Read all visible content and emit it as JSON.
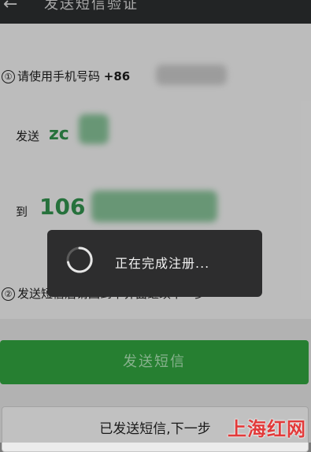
{
  "header": {
    "title": "发送短信验证",
    "back_icon": "back-arrow-icon"
  },
  "steps": [
    {
      "number": "①",
      "text": "请使用手机号码",
      "value": "+86"
    },
    {
      "number": "②",
      "text": "发送短信后请回到本界面继续下一步"
    }
  ],
  "sms": {
    "send_label": "发送",
    "code_prefix": "zc",
    "to_label": "到",
    "number_prefix": "106"
  },
  "buttons": {
    "send_sms": "发送短信",
    "sent_next": "已发送短信,下一步"
  },
  "dialog": {
    "message": "正在完成注册...",
    "spinner_icon": "loading-spinner-icon"
  },
  "watermark": {
    "text": "上海红网"
  },
  "colors": {
    "accent_green": "#2f9c3c",
    "topbar": "#2a2d2e",
    "dialog_bg": "#2d2d2e"
  }
}
